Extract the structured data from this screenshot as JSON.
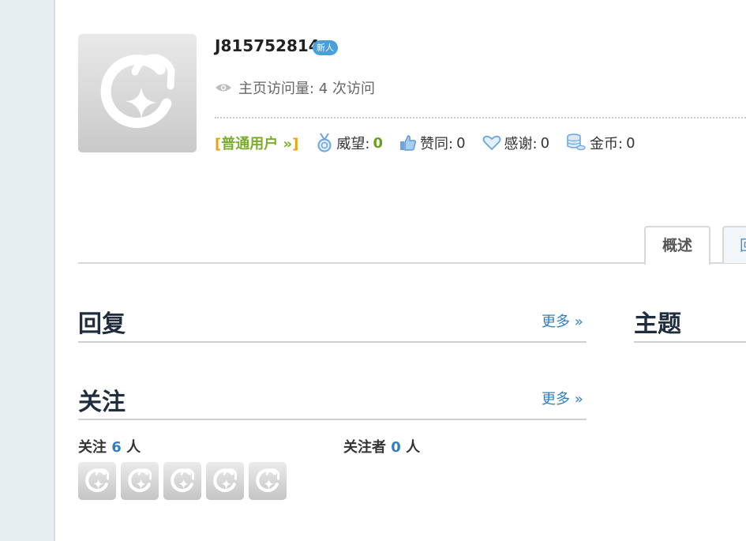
{
  "profile": {
    "username": "J815752814",
    "badge": "新人",
    "visits_text": "主页访问量: 4 次访问"
  },
  "stats": {
    "role_open": "[",
    "role_name": "普通用户 »",
    "role_close": "]",
    "prestige_label": "威望:",
    "prestige_value": "0",
    "likes_label": "赞同:",
    "likes_value": "0",
    "thanks_label": "感谢:",
    "thanks_value": "0",
    "coins_label": "金币:",
    "coins_value": "0"
  },
  "tabs": [
    {
      "label": "概述"
    },
    {
      "label": "回"
    }
  ],
  "sections": {
    "replies_title": "回复",
    "replies_more": "更多 »",
    "topics_title": "主题",
    "follow_title": "关注",
    "follow_more": "更多 »"
  },
  "follow": {
    "following_prefix": "关注 ",
    "following_count": "6",
    "following_suffix": " 人",
    "followers_prefix": "关注者 ",
    "followers_count": "0",
    "followers_suffix": " 人"
  },
  "icons": {
    "eye": "eye-icon",
    "prestige": "medal-icon",
    "likes": "thumbs-up-icon",
    "thanks": "heart-icon",
    "coins": "coins-icon"
  },
  "colors": {
    "accent_blue": "#2f7fc1",
    "role_bracket": "#e8a311",
    "role_text": "#7aad2c",
    "badge_bg": "#4a9fd8"
  }
}
